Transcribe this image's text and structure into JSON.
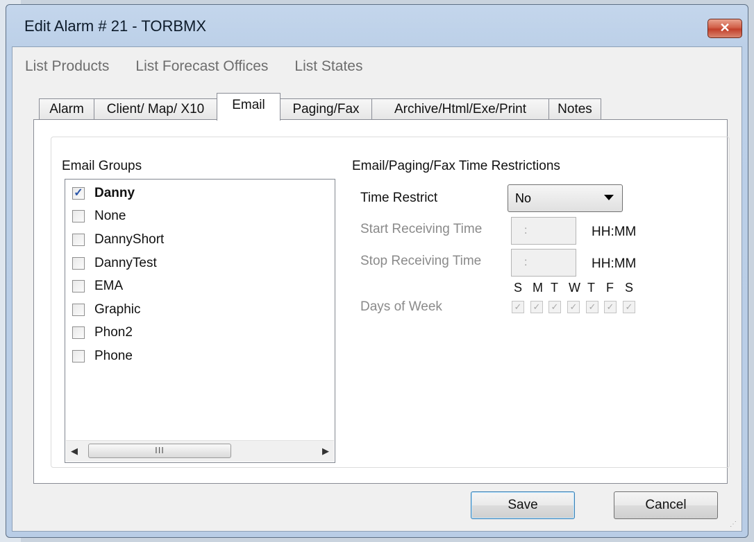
{
  "window": {
    "title": "Edit Alarm # 21 - TORBMX",
    "close_label": "✕"
  },
  "menu": [
    {
      "label": "List Products"
    },
    {
      "label": "List Forecast Offices"
    },
    {
      "label": "List States"
    }
  ],
  "tabs": [
    {
      "label": "Alarm",
      "active": false
    },
    {
      "label": "Client/ Map/ X10",
      "active": false
    },
    {
      "label": "Email",
      "active": true
    },
    {
      "label": "Paging/Fax",
      "active": false
    },
    {
      "label": "Archive/Html/Exe/Print",
      "active": false
    },
    {
      "label": "Notes",
      "active": false
    }
  ],
  "email_groups": {
    "heading": "Email Groups",
    "items": [
      {
        "label": "Danny",
        "checked": true
      },
      {
        "label": "None",
        "checked": false
      },
      {
        "label": "DannyShort",
        "checked": false
      },
      {
        "label": "DannyTest",
        "checked": false
      },
      {
        "label": "EMA",
        "checked": false
      },
      {
        "label": "Graphic",
        "checked": false
      },
      {
        "label": "Phon2",
        "checked": false
      },
      {
        "label": "Phone",
        "checked": false
      }
    ],
    "scroll_thumb_label": "III"
  },
  "restrictions": {
    "heading": "Email/Paging/Fax Time Restrictions",
    "time_restrict_label": "Time Restrict",
    "time_restrict_value": "No",
    "start_label": "Start Receiving Time",
    "start_value": ":",
    "stop_label": "Stop Receiving Time",
    "stop_value": ":",
    "format_hint": "HH:MM",
    "days_label": "Days of Week",
    "days": [
      "S",
      "M",
      "T",
      "W",
      "T",
      "F",
      "S"
    ],
    "days_checked": [
      true,
      true,
      true,
      true,
      true,
      true,
      true
    ]
  },
  "buttons": {
    "save": "Save",
    "cancel": "Cancel"
  }
}
